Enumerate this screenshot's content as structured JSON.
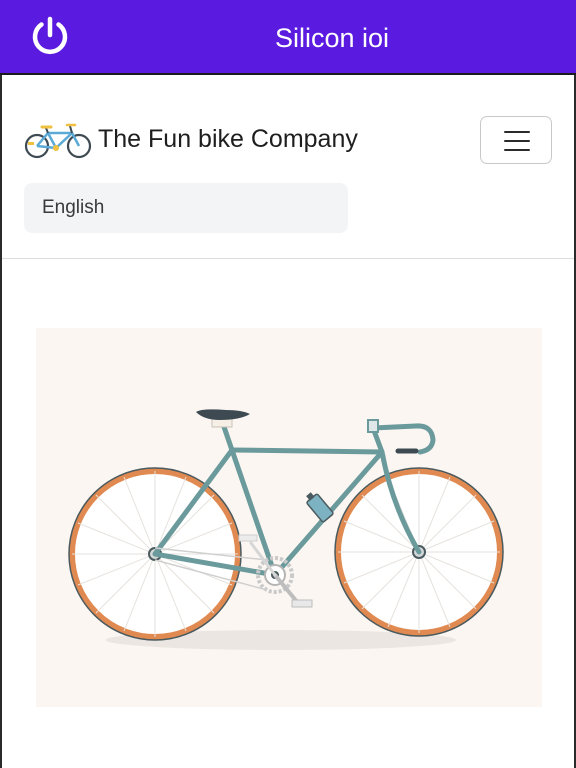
{
  "window": {
    "title": "Silicon ioi",
    "power_icon": "power-icon",
    "titlebar_color": "#5a1ae0"
  },
  "navbar": {
    "brand_name": "The Fun bike Company",
    "brand_logo": "bicycle-logo-icon",
    "menu_icon": "hamburger-menu-icon"
  },
  "language": {
    "selected": "English"
  },
  "hero": {
    "image": "bicycle-illustration",
    "background": "#fbf6f1",
    "frame_color": "#6b9a9c",
    "tire_color": "#e08a52"
  }
}
